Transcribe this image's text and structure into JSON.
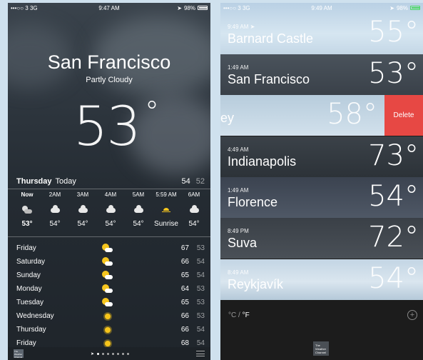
{
  "left": {
    "status": {
      "carrier": "•••○○ 3 3G",
      "time": "9:47 AM",
      "battery": "98%"
    },
    "city": "San Francisco",
    "condition": "Partly Cloudy",
    "temp": "53",
    "deg": "°",
    "today": {
      "day": "Thursday",
      "label": "Today",
      "hi": "54",
      "lo": "52"
    },
    "hourly": [
      {
        "time": "Now",
        "icon": "partly-cloudy-night-icon",
        "temp": "53°"
      },
      {
        "time": "2AM",
        "icon": "cloud-icon",
        "temp": "54°"
      },
      {
        "time": "3AM",
        "icon": "cloud-icon",
        "temp": "54°"
      },
      {
        "time": "4AM",
        "icon": "cloud-icon",
        "temp": "54°"
      },
      {
        "time": "5AM",
        "icon": "cloud-icon",
        "temp": "54°"
      },
      {
        "time": "5:59 AM",
        "icon": "sunrise-icon",
        "temp": "Sunrise"
      },
      {
        "time": "6AM",
        "icon": "cloud-icon",
        "temp": "54°"
      }
    ],
    "daily": [
      {
        "day": "Friday",
        "icon": "partly-sunny-icon",
        "hi": "67",
        "lo": "53"
      },
      {
        "day": "Saturday",
        "icon": "partly-sunny-icon",
        "hi": "66",
        "lo": "54"
      },
      {
        "day": "Sunday",
        "icon": "partly-sunny-icon",
        "hi": "65",
        "lo": "54"
      },
      {
        "day": "Monday",
        "icon": "partly-sunny-icon",
        "hi": "64",
        "lo": "53"
      },
      {
        "day": "Tuesday",
        "icon": "partly-sunny-icon",
        "hi": "65",
        "lo": "53"
      },
      {
        "day": "Wednesday",
        "icon": "sun-icon",
        "hi": "66",
        "lo": "53"
      },
      {
        "day": "Thursday",
        "icon": "sun-icon",
        "hi": "66",
        "lo": "54"
      },
      {
        "day": "Friday",
        "icon": "sun-icon",
        "hi": "68",
        "lo": "54"
      }
    ],
    "twc_logo": "The Weather Channel"
  },
  "right": {
    "status": {
      "carrier": "•••○○ 3 3G",
      "time": "9:49 AM",
      "battery": "98%"
    },
    "cities": [
      {
        "time": "9:49 AM ➤",
        "name": "Barnard Castle",
        "temp": "55°",
        "bg": "linear-gradient(180deg,#b9d0e4,#d6e6f1 60%,#c4d7e6)"
      },
      {
        "time": "1:49 AM",
        "name": "San Francisco",
        "temp": "53°",
        "bg": "linear-gradient(180deg,#4a535c,#3a4149)"
      },
      {
        "time": "",
        "name": "ey",
        "temp": "58°",
        "bg": "linear-gradient(180deg,#b7ccdc,#d2e1ec)",
        "delete": "Delete"
      },
      {
        "time": "4:49 AM",
        "name": "Indianapolis",
        "temp": "73°",
        "bg": "linear-gradient(180deg,#3b4249,#2c3238)"
      },
      {
        "time": "1:49 AM",
        "name": "Florence",
        "temp": "54°",
        "bg": "linear-gradient(180deg,#3b4350,#4f5866)"
      },
      {
        "time": "8:49 PM",
        "name": "Suva",
        "temp": "72°",
        "bg": "linear-gradient(180deg,#3a4047,#4a5057)"
      },
      {
        "time": "8:49 AM",
        "name": "Reykjavík",
        "temp": "54°",
        "bg": "linear-gradient(180deg,#c3d5e4,#dae6ef 55%,#b5c9d9)"
      }
    ],
    "units": {
      "c": "°C",
      "sep": " / ",
      "f": "°F"
    },
    "twc_logo": "The Weather Channel"
  }
}
